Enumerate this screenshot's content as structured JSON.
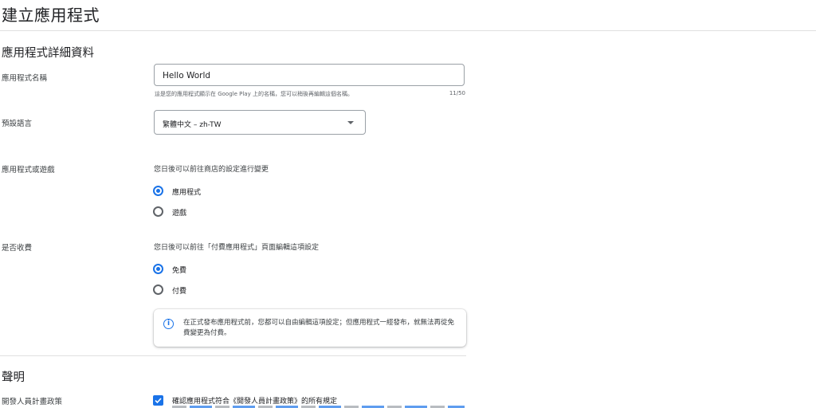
{
  "page": {
    "title": "建立應用程式"
  },
  "details": {
    "title": "應用程式詳細資料",
    "app_name": {
      "label": "應用程式名稱",
      "value": "Hello World",
      "helper": "這是您的應用程式顯示在 Google Play 上的名稱，您可以稍後再編輯這個名稱。",
      "counter": "11/50"
    },
    "default_language": {
      "label": "預設語言",
      "value": "繁體中文 – zh-TW"
    },
    "app_or_game": {
      "label": "應用程式或遊戲",
      "hint": "您日後可以前往商店的設定進行變更",
      "options": [
        {
          "label": "應用程式",
          "selected": true
        },
        {
          "label": "遊戲",
          "selected": false
        }
      ]
    },
    "free_or_paid": {
      "label": "是否收費",
      "hint": "您日後可以前往「付費應用程式」頁面編輯這項設定",
      "options": [
        {
          "label": "免費",
          "selected": true
        },
        {
          "label": "付費",
          "selected": false
        }
      ],
      "info": "在正式發布應用程式前，您都可以自由編輯這項設定；但應用程式一經發布，就無法再從免費變更為付費。"
    }
  },
  "declarations": {
    "title": "聲明",
    "developer_policy": {
      "label": "開發人員計畫政策",
      "checkbox_label": "確認應用程式符合《開發人員計畫政策》的所有規定",
      "checked": true
    }
  },
  "colors": {
    "accent": "#1a73e8",
    "divider": "#e0e0e0"
  }
}
